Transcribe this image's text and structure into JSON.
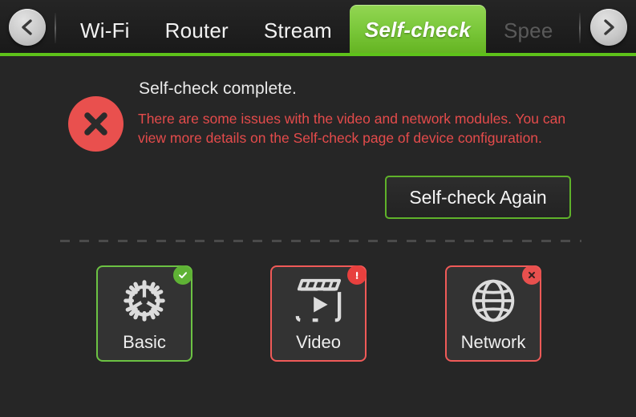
{
  "tabbar": {
    "prev_arrow": "chevron-left-icon",
    "next_arrow": "chevron-right-icon",
    "tabs": [
      {
        "label": "Wi-Fi",
        "state": "normal"
      },
      {
        "label": "Router",
        "state": "normal"
      },
      {
        "label": "Stream",
        "state": "normal"
      },
      {
        "label": "Self-check",
        "state": "active"
      },
      {
        "label": "Spee",
        "state": "dim"
      }
    ],
    "accent_color": "#5ec21a"
  },
  "status": {
    "icon": "error-circle-x-icon",
    "icon_color": "#e9504e",
    "title": "Self-check complete.",
    "message": "There are some issues with the video and network modules. You can view more details on the Self-check page of device configuration.",
    "message_color": "#e44b4b"
  },
  "actions": {
    "recheck_label": "Self-check Again",
    "recheck_border_color": "#5fb22a"
  },
  "modules": [
    {
      "label": "Basic",
      "icon": "gear-icon",
      "state": "ok",
      "border_color": "#6cc243",
      "badge": "check-badge",
      "badge_color": "#5fb235"
    },
    {
      "label": "Video",
      "icon": "clapperboard-play-icon",
      "state": "error",
      "border_color": "#f05a58",
      "badge": "exclamation-badge",
      "badge_color": "#e8403e"
    },
    {
      "label": "Network",
      "icon": "globe-icon",
      "state": "error",
      "border_color": "#f05a58",
      "badge": "cross-badge",
      "badge_color": "#e8504e"
    }
  ]
}
